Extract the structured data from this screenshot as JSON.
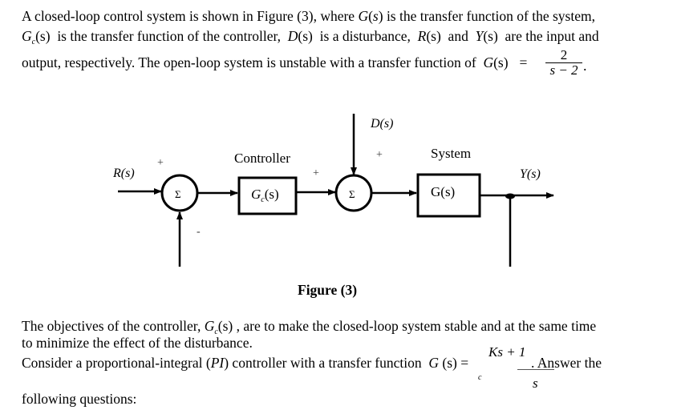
{
  "intro": {
    "line1": {
      "a": "A closed-loop control system is shown in Figure (3), where ",
      "G": "G",
      "s": "s",
      "b": " is the transfer function of the system,"
    },
    "line2": {
      "Gc_G": "G",
      "Gc_c": "c",
      "Gc_s": "(s)",
      "a": "  is the transfer function of the controller,  ",
      "D": "D",
      "D_s": "(s)",
      "b": "  is a disturbance,  ",
      "R": "R",
      "R_s": "(s)",
      "c": "  and  ",
      "Y": "Y",
      "Y_s": "(s)",
      "d": "  are the input and"
    },
    "line3": {
      "a": "output, respectively. The open-loop system is unstable with a transfer function of  ",
      "G": "G",
      "s": "(s)",
      "eq": "=",
      "numerator": "2",
      "denominator": "s − 2",
      "end": "."
    }
  },
  "figure": {
    "caption": "Figure (3)",
    "labels": {
      "input": "R(s)",
      "output": "Y(s)",
      "disturbance": "D(s)",
      "controller_title": "Controller",
      "controller_block_G": "G",
      "controller_block_c": "c",
      "controller_block_s": "(s)",
      "system_title": "System",
      "system_block": "G(s)",
      "summer_symbol": "Σ",
      "sign_plus": "+",
      "sign_minus": "-"
    }
  },
  "body": {
    "para1": {
      "a": "The objectives of the controller, ",
      "Gc_G": "G",
      "Gc_c": "c",
      "Gc_s": "(s)",
      "b": " , are to make the closed-loop system stable and at the same time"
    },
    "para1_line2": "to minimize the effect of the  disturbance.",
    "para2": {
      "a": "Consider a proportional-integral (",
      "PI": "PI",
      "b": ") controller with a transfer function  ",
      "G": "G",
      "s": " (s) =",
      "c": "c",
      "numerator": "Ks + 1",
      "denominator": "s",
      "end": ". Answer the"
    },
    "para3": "following questions:"
  }
}
